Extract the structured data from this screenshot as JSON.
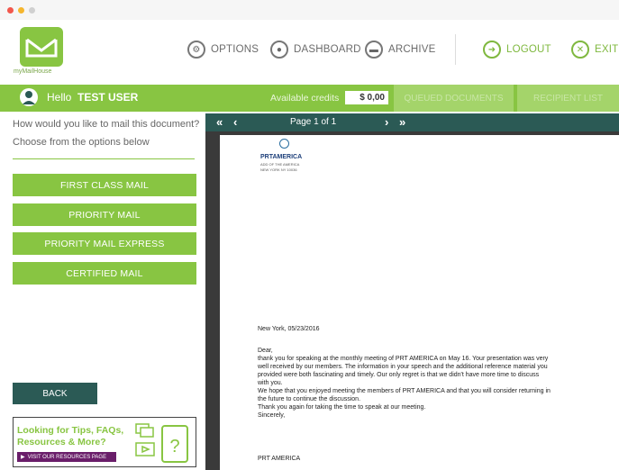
{
  "app": {
    "logo_text": "myMailHouse"
  },
  "nav": {
    "options": "OPTIONS",
    "dashboard": "DASHBOARD",
    "archive": "ARCHIVE",
    "logout": "LOGOUT",
    "exit": "EXIT"
  },
  "userbar": {
    "hello": "Hello",
    "username": "TEST USER",
    "credits_label": "Available credits",
    "credits_value": "$ 0,00",
    "queued": "QUEUED DOCUMENTS",
    "recipient": "RECIPIENT LIST"
  },
  "left": {
    "question": "How would you like to mail this document?",
    "instruction": "Choose from the options below",
    "mail_options": [
      "FIRST CLASS MAIL",
      "PRIORITY MAIL",
      "PRIORITY MAIL EXPRESS",
      "CERTIFIED MAIL"
    ],
    "back": "BACK",
    "resources_text": "Looking for Tips, FAQs, Resources & More?",
    "resources_button": "VISIT OUR RESOURCES PAGE"
  },
  "viewer": {
    "first": "«",
    "prev": "‹",
    "page_label": "Page 1 of 1",
    "next": "›",
    "last": "»"
  },
  "document": {
    "logo_name": "PRTAMERICA",
    "logo_sub1": "ADD OF THE AMERICA",
    "logo_sub2": "NEW YORK NY 10036",
    "date_line": "New York, 05/23/2016",
    "greeting": "Dear,",
    "body": [
      "thank you for speaking at the monthly meeting of PRT AMERICA on May 16. Your presentation was very",
      "well received by our members. The information in your speech and the additional reference material you",
      "provided were both fascinating and timely. Our only regret is that we didn't have more time to discuss",
      "with you.",
      "We hope that you enjoyed meeting the members of PRT AMERICA and that you will consider returning in",
      "the future to continue the discussion.",
      "Thank you again for taking the time to speak at our meeting.",
      "Sincerely,"
    ],
    "signature": "PRT AMERICA"
  },
  "colors": {
    "green": "#88c542",
    "teal": "#2b5a55",
    "purple": "#6a1e6a"
  }
}
